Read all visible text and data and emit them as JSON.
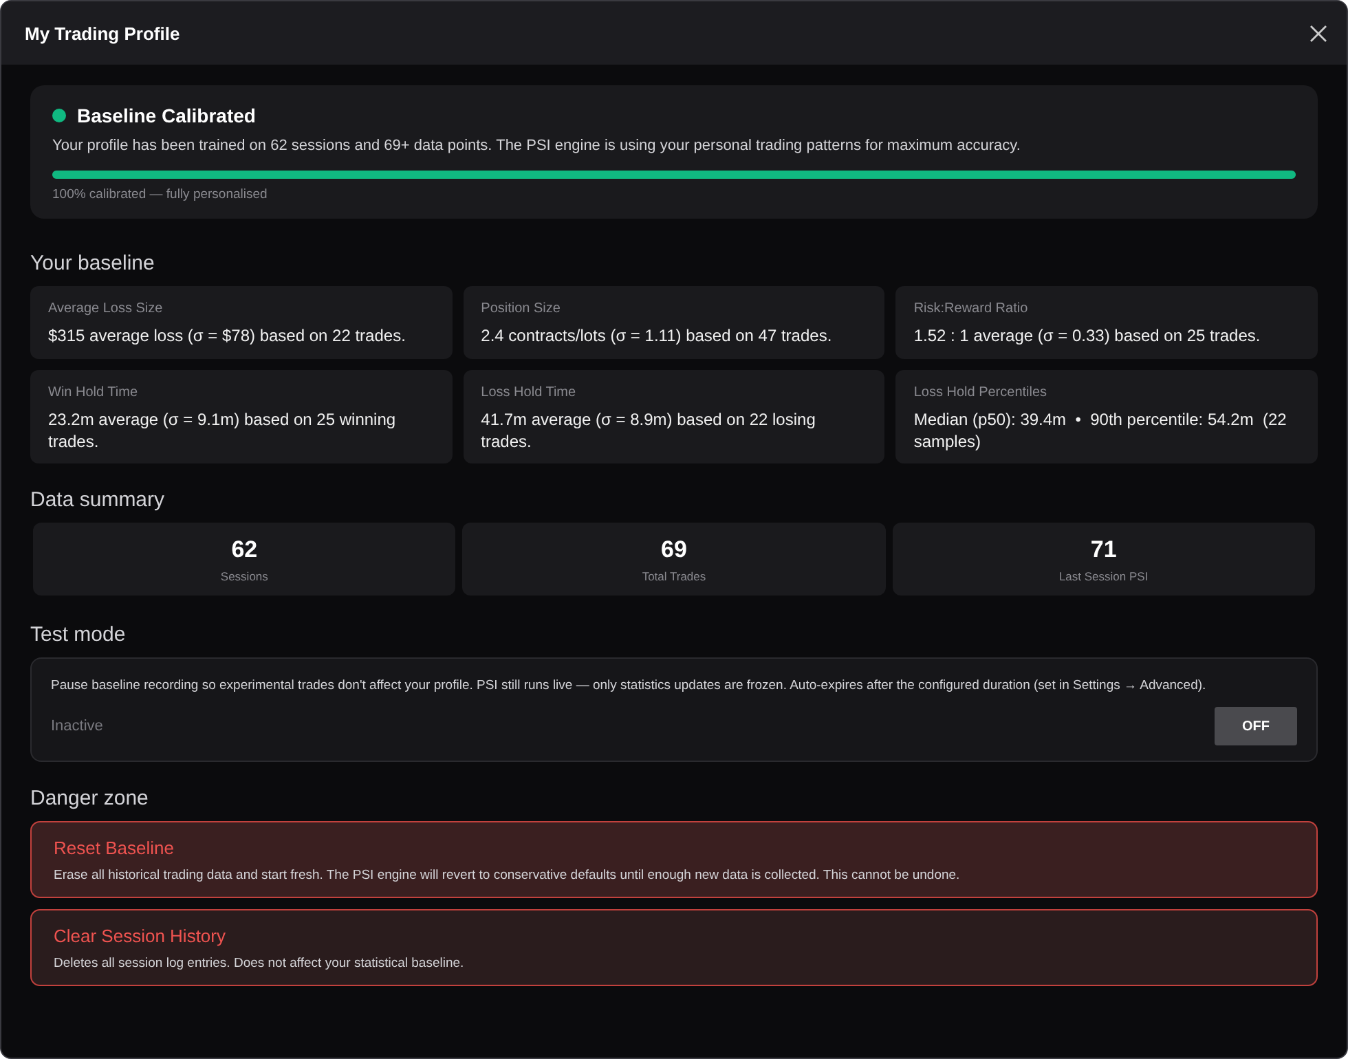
{
  "window": {
    "title": "My Trading Profile"
  },
  "calibration": {
    "title": "Baseline Calibrated",
    "calibrated": true,
    "description": "Your profile has been trained on 62 sessions and 69+ data points. The PSI engine is using your personal trading patterns for maximum accuracy.",
    "level": 1,
    "caption": "100% calibrated — fully personalised"
  },
  "baseline": {
    "heading": "Your baseline",
    "cards": [
      {
        "label": "Average Loss Size",
        "value": "$315 average loss (σ = $78) based on 22 trades."
      },
      {
        "label": "Position Size",
        "value": "2.4 contracts/lots (σ = 1.11) based on 47 trades."
      },
      {
        "label": "Risk:Reward Ratio",
        "value": "1.52 : 1 average (σ = 0.33) based on 25 trades."
      },
      {
        "label": "Win Hold Time",
        "value": "23.2m average (σ = 9.1m) based on 25 winning trades."
      },
      {
        "label": "Loss Hold Time",
        "value": "41.7m average (σ = 8.9m) based on 22 losing trades."
      },
      {
        "label": "Loss Hold Percentiles",
        "value": "Median (p50): 39.4m  •  90th percentile: 54.2m  (22 samples)"
      }
    ]
  },
  "summary": {
    "heading": "Data summary",
    "stats": [
      {
        "value": "62",
        "label": "Sessions"
      },
      {
        "value": "69",
        "label": "Total Trades"
      },
      {
        "value": "71",
        "label": "Last Session PSI"
      }
    ]
  },
  "test_mode": {
    "heading": "Test mode",
    "description": "Pause baseline recording so experimental trades don't affect your profile. PSI still runs live — only statistics updates are frozen. Auto-expires after the configured duration (set in Settings → Advanced).",
    "status": "Inactive",
    "on": false,
    "toggle_label": "OFF"
  },
  "danger": {
    "heading": "Danger zone",
    "actions": [
      {
        "title": "Reset Baseline",
        "description": "Erase all historical trading data and start fresh. The PSI engine will revert to conservative defaults until enough new data is collected. This cannot be undone.",
        "hovered": true
      },
      {
        "title": "Clear Session History",
        "description": "Deletes all session log entries. Does not affect your statistical baseline.",
        "hovered": false
      }
    ]
  }
}
